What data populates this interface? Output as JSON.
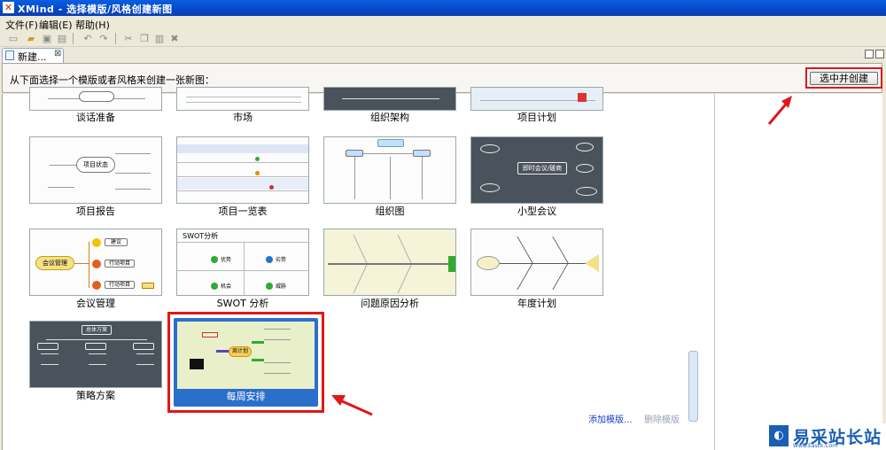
{
  "window": {
    "title": "XMind - 选择模版/风格创建新图"
  },
  "menu": {
    "file": "文件(F)",
    "edit": "编辑(E)",
    "help": "帮助(H)"
  },
  "editor_tab": {
    "label": "新建..."
  },
  "header": {
    "prompt": "从下面选择一个模版或者风格来创建一张新图：",
    "create_button": "选中并创建"
  },
  "templates": [
    {
      "label": "谈话准备"
    },
    {
      "label": "市场"
    },
    {
      "label": "组织架构"
    },
    {
      "label": "项目计划"
    },
    {
      "label": "项目报告"
    },
    {
      "label": "项目一览表"
    },
    {
      "label": "组织图"
    },
    {
      "label": "小型会议"
    },
    {
      "label": "会议管理"
    },
    {
      "label": "SWOT 分析"
    },
    {
      "label": "问题原因分析"
    },
    {
      "label": "年度计划"
    },
    {
      "label": "策略方案"
    },
    {
      "label": "每周安排",
      "selected": true
    }
  ],
  "thumb_text": {
    "report_center": "项目状态",
    "meeting_center": "即时会议/磋商",
    "meeting_mgmt_center": "会议管理",
    "meeting_mgmt_item1": "建议",
    "meeting_mgmt_item2": "行动项目",
    "meeting_mgmt_item3": "行动项目",
    "swot_title": "SWOT分析",
    "swot_strengths": "优势",
    "swot_weaknesses": "劣势",
    "swot_opportunities": "机会",
    "swot_threats": "威胁",
    "strategy_root": "总体方案",
    "week_center": "周计划"
  },
  "actions": {
    "add_template": "添加模版...",
    "delete_template": "删除模版"
  },
  "watermark": {
    "brand": "易采站长站",
    "url": "Www.Easck.Com"
  },
  "colors": {
    "accent_red": "#e01818",
    "selection_blue": "#2b6fcc",
    "titlebar_blue": "#0548c7"
  }
}
